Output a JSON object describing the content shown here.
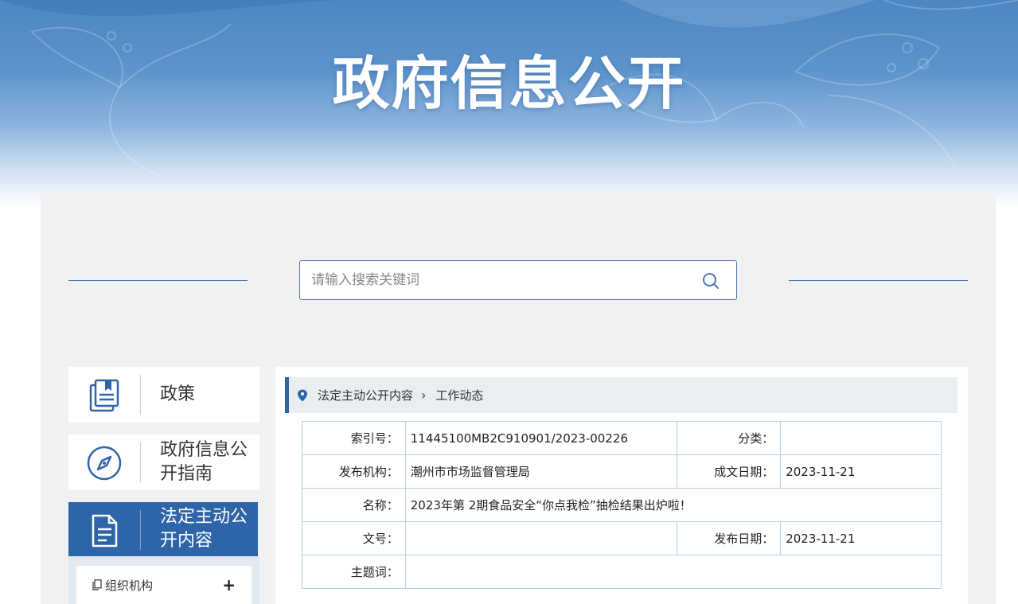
{
  "banner": {
    "title": "政府信息公开"
  },
  "search": {
    "placeholder": "请输入搜索关键词",
    "icon": "search-icon"
  },
  "nav": {
    "items": [
      {
        "label": "政策",
        "icon": "policy-book-icon",
        "active": false
      },
      {
        "label": "政府信息公开指南",
        "icon": "compass-icon",
        "active": false
      },
      {
        "label": "法定主动公开内容",
        "icon": "document-icon",
        "active": true
      }
    ],
    "subnav": {
      "label": "组织机构",
      "expand": "+"
    }
  },
  "breadcrumb": {
    "level1": "法定主动公开内容",
    "separator": "›",
    "level2": "工作动态"
  },
  "meta": {
    "index_label": "索引号：",
    "index_value": "11445100MB2C910901/2023-00226",
    "category_label": "分类：",
    "category_value": "",
    "publisher_label": "发布机构：",
    "publisher_value": "潮州市市场监督管理局",
    "created_label": "成文日期：",
    "created_value": "2023-11-21",
    "name_label": "名称：",
    "name_value": "2023年第 2期食品安全“你点我检”抽检结果出炉啦！",
    "docno_label": "文号：",
    "docno_value": "",
    "pubdate_label": "发布日期：",
    "pubdate_value": "2023-11-21",
    "keywords_label": "主题词：",
    "keywords_value": ""
  },
  "colors": {
    "accent": "#2d65a8",
    "line": "#4a79ad",
    "panel": "#f1f1f1",
    "border": "#b9cfe2"
  }
}
